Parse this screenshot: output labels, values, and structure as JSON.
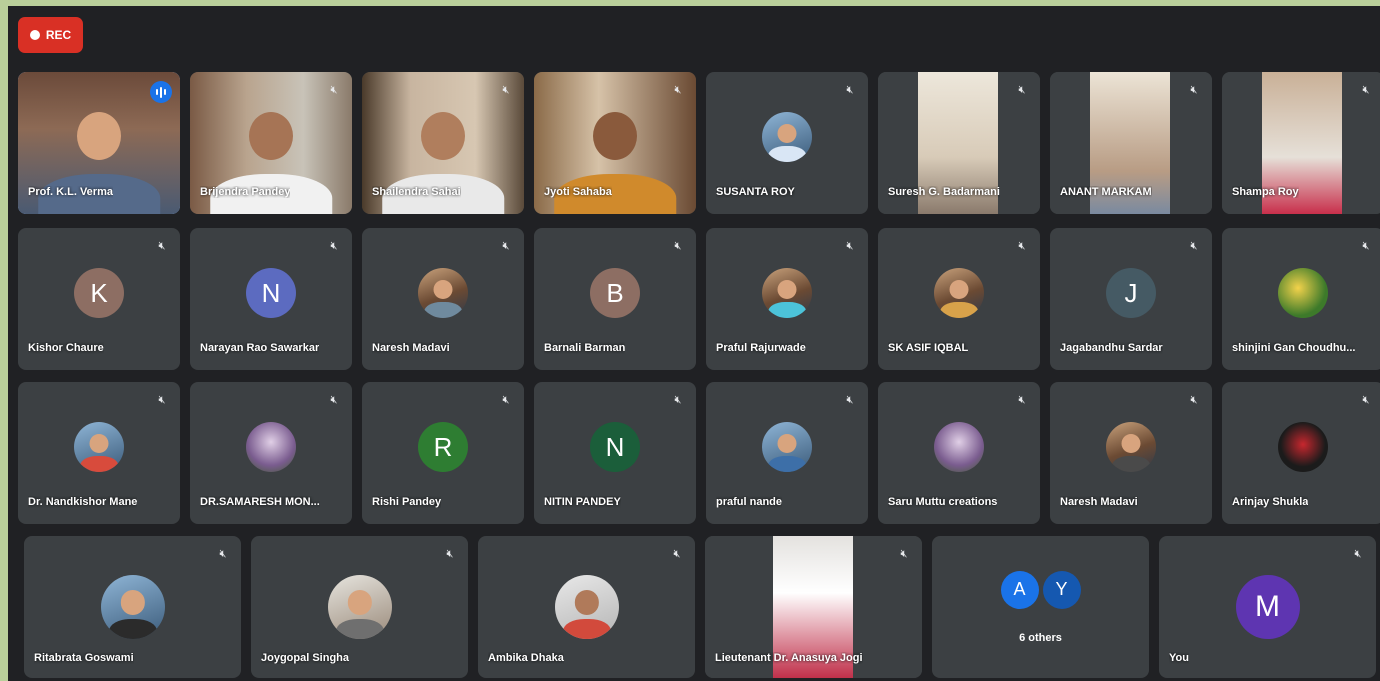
{
  "rec_label": "REC",
  "colors": {
    "rec": "#d93025",
    "active_border": "#8ab4f8",
    "tile": "#3c4043",
    "background": "#202124"
  },
  "icons": {
    "mute": "mic-off-icon",
    "speaking": "speaking-indicator-icon",
    "record": "record-dot-icon"
  },
  "row1": [
    {
      "name": "Prof. K.L. Verma",
      "status": "speaking"
    },
    {
      "name": "Brijendra Pandey",
      "status": "muted"
    },
    {
      "name": "Shailendra Sahai",
      "status": "muted"
    },
    {
      "name": "Jyoti Sahaba",
      "status": "muted"
    },
    {
      "name": "SUSANTA ROY",
      "status": "muted"
    },
    {
      "name": "Suresh G. Badarmani",
      "status": "muted"
    },
    {
      "name": "ANANT MARKAM",
      "status": "muted"
    },
    {
      "name": "Shampa Roy",
      "status": "muted"
    }
  ],
  "row2": [
    {
      "name": "Kishor Chaure",
      "initial": "K",
      "color": "#8d6e63"
    },
    {
      "name": "Narayan Rao Sawarkar",
      "initial": "N",
      "color": "#5c6bc0"
    },
    {
      "name": "Naresh Madavi"
    },
    {
      "name": "Barnali Barman",
      "initial": "B",
      "color": "#8d6e63"
    },
    {
      "name": "Praful Rajurwade"
    },
    {
      "name": "SK ASIF IQBAL"
    },
    {
      "name": "Jagabandhu Sardar",
      "initial": "J",
      "color": "#455a64"
    },
    {
      "name": "shinjini Gan Choudhu..."
    }
  ],
  "row3": [
    {
      "name": "Dr. Nandkishor Mane"
    },
    {
      "name": "DR.SAMARESH MON..."
    },
    {
      "name": "Rishi Pandey",
      "initial": "R",
      "color": "#2e7d32"
    },
    {
      "name": "NITIN PANDEY",
      "initial": "N",
      "color": "#1b5e3a"
    },
    {
      "name": "praful nande"
    },
    {
      "name": "Saru Muttu creations"
    },
    {
      "name": "Naresh Madavi"
    },
    {
      "name": "Arinjay Shukla"
    }
  ],
  "row4": [
    {
      "name": "Ritabrata Goswami"
    },
    {
      "name": "Joygopal Singha"
    },
    {
      "name": "Ambika Dhaka"
    },
    {
      "name": "Lieutenant Dr. Anasuya Jogi"
    },
    {
      "name": "6 others",
      "initials": [
        "A",
        "Y"
      ]
    },
    {
      "name": "You",
      "initial": "M",
      "color": "#5e35b1"
    }
  ]
}
